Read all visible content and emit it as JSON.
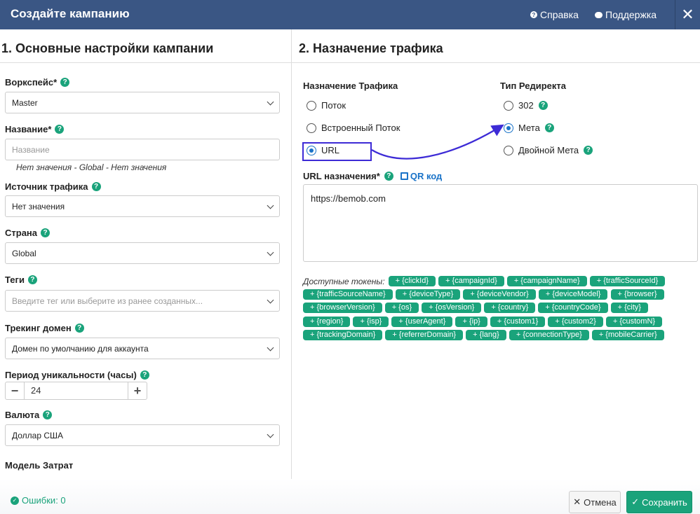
{
  "header": {
    "title": "Создайте кампанию",
    "help_label": "Справка",
    "support_label": "Поддержка",
    "close_glyph": "✕"
  },
  "left": {
    "section_title": "1. Основные настройки кампании",
    "workspace": {
      "label": "Воркспейс*",
      "value": "Master"
    },
    "name": {
      "label": "Название*",
      "placeholder": "Название",
      "hint": "Нет значения - Global - Нет значения"
    },
    "traffic_source": {
      "label": "Источник трафика",
      "value": "Нет значения"
    },
    "country": {
      "label": "Страна",
      "value": "Global"
    },
    "tags": {
      "label": "Теги",
      "placeholder": "Введите тег или выберите из ранее созданных..."
    },
    "tracking_domain": {
      "label": "Трекинг домен",
      "value": "Домен по умолчанию для аккаунта"
    },
    "uniqueness": {
      "label": "Период уникальности (часы)",
      "value": "24",
      "minus": "−",
      "plus": "+"
    },
    "currency": {
      "label": "Валюта",
      "value": "Доллар США"
    },
    "cost_model": {
      "label": "Модель Затрат"
    }
  },
  "right": {
    "section_title": "2. Назначение трафика",
    "destination": {
      "label": "Назначение Трафика",
      "options": [
        "Поток",
        "Встроенный Поток",
        "URL"
      ],
      "selected": "URL"
    },
    "redirect": {
      "label": "Тип Редиректа",
      "options": [
        "302",
        "Мета",
        "Двойной Мета"
      ],
      "selected": "Мета"
    },
    "dest_url": {
      "label": "URL назначения*",
      "qr_label": "QR код",
      "value": "https://bemob.com"
    },
    "tokens_label": "Доступные токены:",
    "tokens": [
      "+ {clickId}",
      "+ {campaignId}",
      "+ {campaignName}",
      "+ {trafficSourceId}",
      "+ {trafficSourceName}",
      "+ {deviceType}",
      "+ {deviceVendor}",
      "+ {deviceModel}",
      "+ {browser}",
      "+ {browserVersion}",
      "+ {os}",
      "+ {osVersion}",
      "+ {country}",
      "+ {countryCode}",
      "+ {city}",
      "+ {region}",
      "+ {isp}",
      "+ {userAgent}",
      "+ {ip}",
      "+ {custom1}",
      "+ {custom2}",
      "+ {customN}",
      "+ {trackingDomain}",
      "+ {referrerDomain}",
      "+ {lang}",
      "+ {connectionType}",
      "+ {mobileCarrier}"
    ]
  },
  "footer": {
    "errors_label": "Ошибки: 0",
    "cancel_label": "Отмена",
    "save_label": "Сохранить"
  },
  "colors": {
    "header": "#3a5684",
    "accent": "#1aa37b",
    "link": "#1a73c8",
    "highlight": "#3d2bd6"
  }
}
